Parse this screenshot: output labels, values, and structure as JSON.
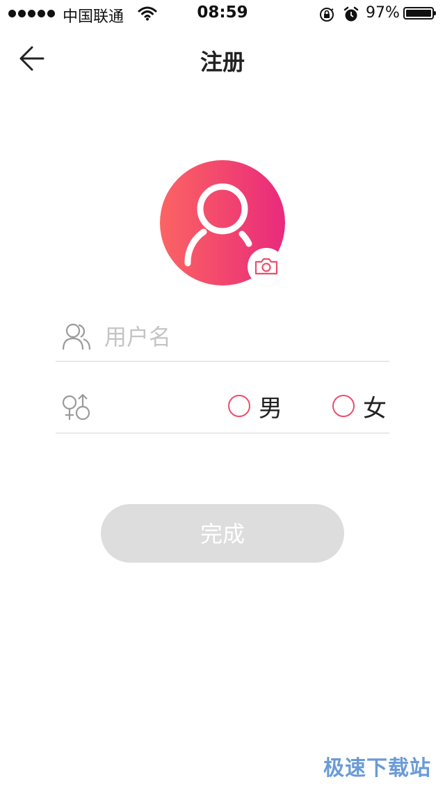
{
  "status_bar": {
    "carrier": "中国联通",
    "time": "08:59",
    "battery": "97%",
    "battery_level": 0.97,
    "icons": [
      "signal-dots",
      "wifi-icon",
      "rotation-lock-icon",
      "alarm-icon",
      "battery-icon"
    ]
  },
  "nav": {
    "title": "注册",
    "back_icon": "arrow-left-icon"
  },
  "avatar": {
    "icon": "person-icon",
    "camera_icon": "camera-icon",
    "colors": {
      "gradient_start": "#fb6463",
      "gradient_end": "#e92a7d"
    }
  },
  "form": {
    "username": {
      "icon": "users-icon",
      "placeholder": "用户名",
      "value": ""
    },
    "gender": {
      "icon": "gender-icon",
      "options": [
        {
          "label": "男",
          "selected": false
        },
        {
          "label": "女",
          "selected": false
        }
      ]
    }
  },
  "submit": {
    "label": "完成",
    "enabled": false
  },
  "watermark": "极速下载站",
  "colors": {
    "accent": "#ef4c6b",
    "button_disabled": "#dddddd",
    "divider": "#e8e8e8"
  }
}
